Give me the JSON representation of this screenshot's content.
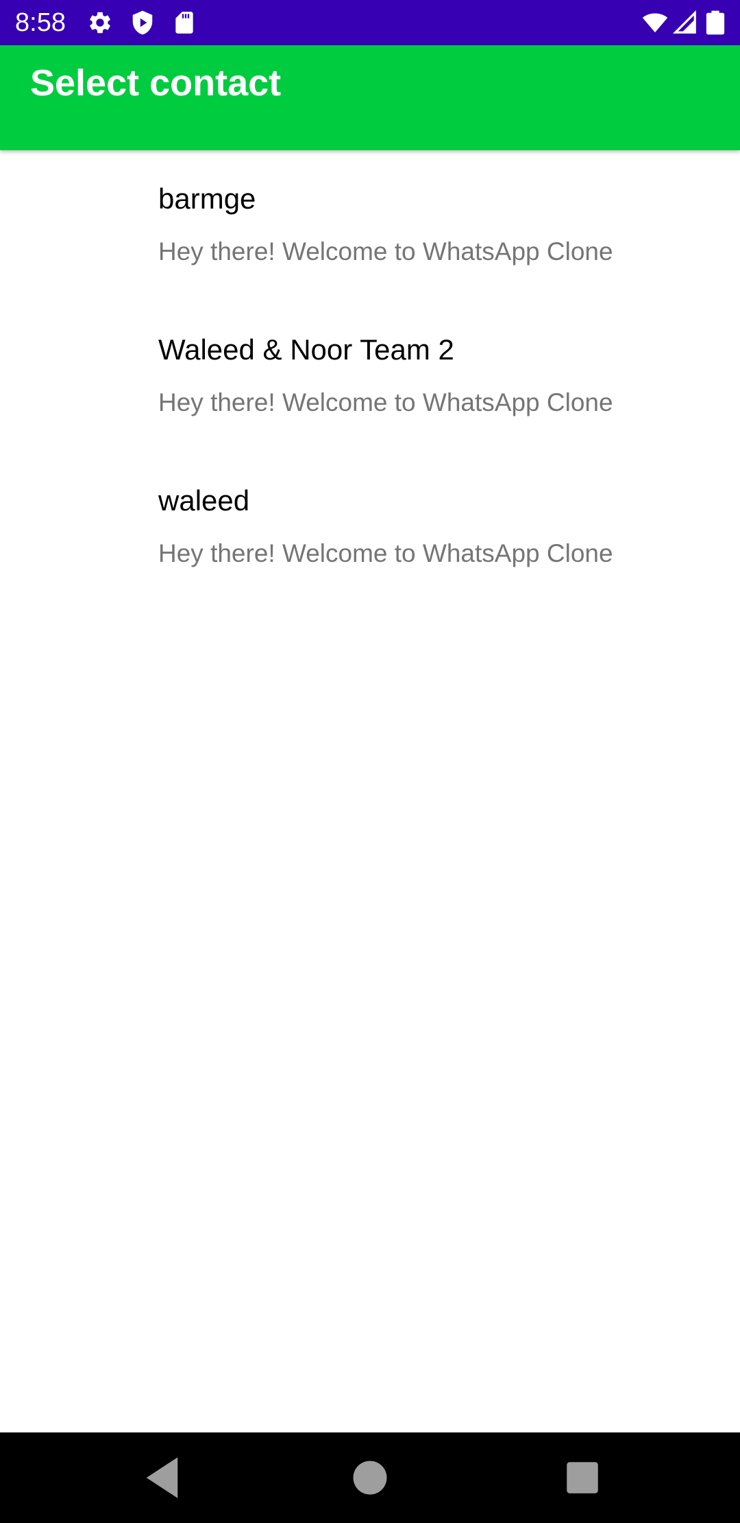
{
  "status_bar": {
    "time": "8:58",
    "icons": [
      "gear-icon",
      "shield-play-icon",
      "sd-card-icon",
      "wifi-icon",
      "cellular-signal-icon",
      "battery-icon"
    ],
    "background": "#3700b3"
  },
  "app_bar": {
    "title": "Select contact",
    "background": "#00cc3f"
  },
  "contacts": [
    {
      "name": "barmge",
      "status": "Hey there! Welcome to WhatsApp Clone"
    },
    {
      "name": "Waleed & Noor Team 2",
      "status": "Hey there! Welcome to WhatsApp Clone"
    },
    {
      "name": "waleed",
      "status": "Hey there! Welcome to WhatsApp Clone"
    }
  ],
  "nav_bar": {
    "buttons": [
      "back-icon",
      "home-icon",
      "recents-icon"
    ]
  }
}
